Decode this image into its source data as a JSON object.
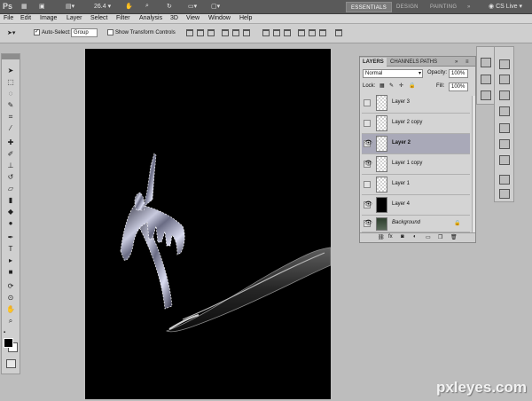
{
  "app": {
    "logo": "Ps",
    "zoom_value": "26.4",
    "workspaces": [
      "ESSENTIALS",
      "DESIGN",
      "PAINTING"
    ],
    "more": "»",
    "live_label": "CS Live"
  },
  "menu": [
    "File",
    "Edit",
    "Image",
    "Layer",
    "Select",
    "Filter",
    "Analysis",
    "3D",
    "View",
    "Window",
    "Help"
  ],
  "options": {
    "auto_select_label": "Auto-Select:",
    "auto_select_checked": "✓",
    "auto_select_value": "Group",
    "show_transform_label": "Show Transform Controls"
  },
  "layers_panel": {
    "tabs": [
      "LAYERS",
      "CHANNELS",
      "PATHS"
    ],
    "blend_mode": "Normal",
    "opacity_label": "Opacity:",
    "opacity_value": "100%",
    "lock_label": "Lock:",
    "fill_label": "Fill:",
    "fill_value": "100%",
    "layers": [
      {
        "name": "Layer 3",
        "visible": false,
        "selected": false
      },
      {
        "name": "Layer 2 copy",
        "visible": false,
        "selected": false
      },
      {
        "name": "Layer 2",
        "visible": true,
        "selected": true
      },
      {
        "name": "Layer 1 copy",
        "visible": true,
        "selected": false
      },
      {
        "name": "Layer 1",
        "visible": false,
        "selected": false
      },
      {
        "name": "Layer 4",
        "visible": true,
        "selected": false
      },
      {
        "name": "Background",
        "visible": true,
        "selected": false
      }
    ]
  },
  "watermark": "pxleyes.com",
  "colors": {
    "canvas_bg": "#000000",
    "selected_layer": "#a9a9b8",
    "panel_bg": "#d4d4d4"
  }
}
